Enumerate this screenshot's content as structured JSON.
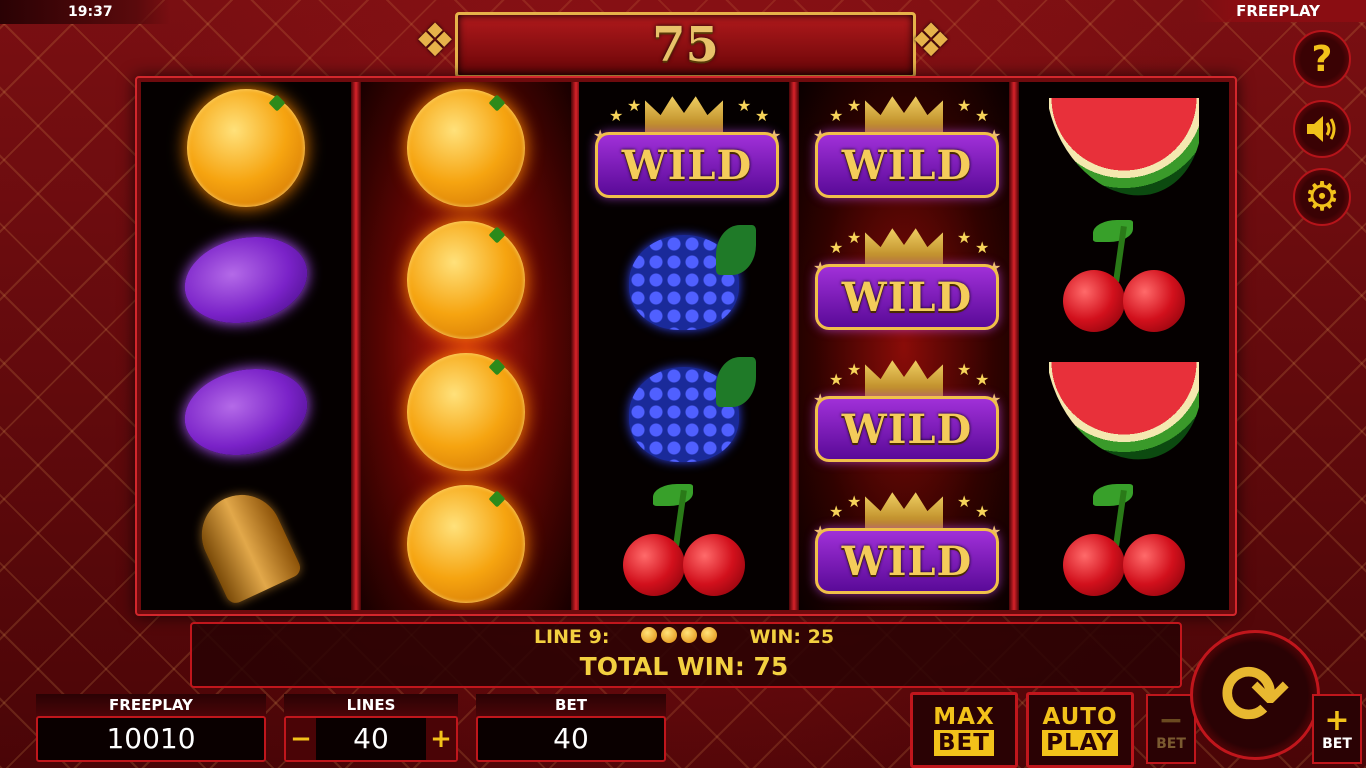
{
  "status_bar": {
    "time": "19:37",
    "mode": "FREEPLAY"
  },
  "win_banner": {
    "amount": "75"
  },
  "reels": [
    [
      "orange",
      "plum",
      "plum",
      "bell"
    ],
    [
      "orange",
      "orange",
      "orange",
      "orange"
    ],
    [
      "wild",
      "grapes",
      "grapes",
      "cherry"
    ],
    [
      "wild",
      "wild",
      "wild",
      "wild"
    ],
    [
      "watermelon",
      "cherry",
      "watermelon",
      "cherry"
    ]
  ],
  "wild_label": "WILD",
  "win_info": {
    "line_label": "LINE 9:",
    "win_label": "WIN: 25",
    "total_win_label": "TOTAL WIN: 75",
    "coin_count": 4
  },
  "panels": {
    "freeplay": {
      "label": "FREEPLAY",
      "value": "10010"
    },
    "lines": {
      "label": "LINES",
      "value": "40",
      "minus": "−",
      "plus": "+"
    },
    "bet": {
      "label": "BET",
      "value": "40"
    }
  },
  "buttons": {
    "max_bet": {
      "line1": "MAX",
      "line2": "BET"
    },
    "auto_play": {
      "line1": "AUTO",
      "line2": "PLAY"
    },
    "bet_minus": {
      "glyph": "−",
      "label": "BET"
    },
    "bet_plus": {
      "glyph": "+",
      "label": "BET"
    },
    "help": "?",
    "sound_icon": "speaker-icon",
    "settings_icon": "gear-icon",
    "spin_icon": "refresh-icon"
  },
  "colors": {
    "accent_gold": "#f2c21a",
    "frame_red": "#c0161c"
  }
}
